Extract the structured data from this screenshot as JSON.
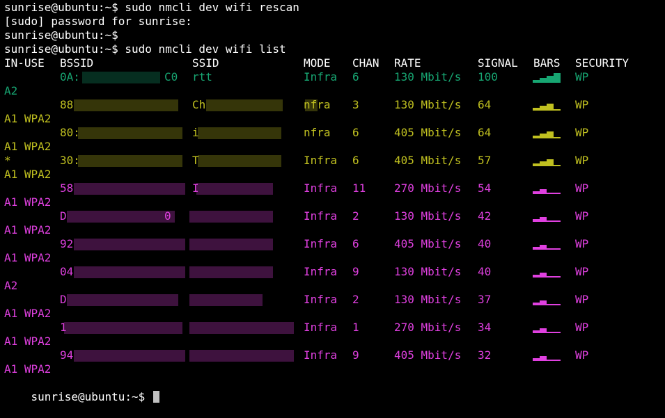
{
  "terminal": {
    "lines": [
      "sunrise@ubuntu:~$ sudo nmcli dev wifi rescan",
      "[sudo] password for sunrise:",
      "sunrise@ubuntu:~$",
      "sunrise@ubuntu:~$ sudo nmcli dev wifi list"
    ],
    "final_prompt": "sunrise@ubuntu:~$ "
  },
  "table": {
    "headers": {
      "in_use": "IN-USE",
      "bssid": "BSSID",
      "ssid": "SSID",
      "mode": "MODE",
      "chan": "CHAN",
      "rate": "RATE",
      "signal": "SIGNAL",
      "bars": "BARS",
      "security": "SECURITY"
    },
    "rows": [
      {
        "bssid": "0A:",
        "bssid_end": "C0",
        "ssid": "rtt",
        "mode": "Infra",
        "chan": "6",
        "rate": "130 Mbit/s",
        "signal": "100",
        "bars_level": 4,
        "security": "WP",
        "wrap": "A2",
        "in_use": "",
        "color": "#17a672"
      },
      {
        "bssid": "88",
        "bssid_end": "",
        "ssid": "Ch",
        "mode": "nfra",
        "chan": "3",
        "rate": "130 Mbit/s",
        "signal": "64",
        "bars_level": 3,
        "security": "WP",
        "wrap": "A1 WPA2",
        "in_use": "",
        "color": "#c0c020"
      },
      {
        "bssid": "80:",
        "bssid_end": "",
        "ssid": "i",
        "mode": "nfra",
        "chan": "6",
        "rate": "405 Mbit/s",
        "signal": "64",
        "bars_level": 3,
        "security": "WP",
        "wrap": "A1 WPA2",
        "in_use": "",
        "color": "#c0c020"
      },
      {
        "bssid": "30:",
        "bssid_end": "",
        "ssid": "T",
        "mode": "Infra",
        "chan": "6",
        "rate": "405 Mbit/s",
        "signal": "57",
        "bars_level": 3,
        "security": "WP",
        "wrap": "A1 WPA2",
        "in_use": "*",
        "color": "#c0c020"
      },
      {
        "bssid": "58",
        "bssid_end": "",
        "ssid": "I",
        "mode": "Infra",
        "chan": "11",
        "rate": "270 Mbit/s",
        "signal": "54",
        "bars_level": 2,
        "security": "WP",
        "wrap": "A1 WPA2",
        "in_use": "",
        "color": "#e040e0"
      },
      {
        "bssid": "D",
        "bssid_end": "0",
        "ssid": "",
        "mode": "Infra",
        "chan": "2",
        "rate": "130 Mbit/s",
        "signal": "42",
        "bars_level": 2,
        "security": "WP",
        "wrap": "A1 WPA2",
        "in_use": "",
        "color": "#e040e0"
      },
      {
        "bssid": "92",
        "bssid_end": "",
        "ssid": "",
        "mode": "Infra",
        "chan": "6",
        "rate": "405 Mbit/s",
        "signal": "40",
        "bars_level": 2,
        "security": "WP",
        "wrap": "A1 WPA2",
        "in_use": "",
        "color": "#e040e0"
      },
      {
        "bssid": "04",
        "bssid_end": "",
        "ssid": "",
        "mode": "Infra",
        "chan": "9",
        "rate": "130 Mbit/s",
        "signal": "40",
        "bars_level": 2,
        "security": "WP",
        "wrap": "A2",
        "in_use": "",
        "color": "#e040e0"
      },
      {
        "bssid": "D",
        "bssid_end": "",
        "ssid": "",
        "mode": "Infra",
        "chan": "2",
        "rate": "130 Mbit/s",
        "signal": "37",
        "bars_level": 2,
        "security": "WP",
        "wrap": "A1 WPA2",
        "in_use": "",
        "color": "#e040e0"
      },
      {
        "bssid": "1",
        "bssid_end": "",
        "ssid": "",
        "mode": "Infra",
        "chan": "1",
        "rate": "270 Mbit/s",
        "signal": "34",
        "bars_level": 2,
        "security": "WP",
        "wrap": "A1 WPA2",
        "in_use": "",
        "color": "#e040e0"
      },
      {
        "bssid": "94",
        "bssid_end": "",
        "ssid": "",
        "mode": "Infra",
        "chan": "9",
        "rate": "405 Mbit/s",
        "signal": "32",
        "bars_level": 2,
        "security": "WP",
        "wrap": "A1 WPA2",
        "in_use": "",
        "color": "#e040e0"
      }
    ]
  },
  "colors": {
    "background": "#000000",
    "text": "#ffffff",
    "strong": "#17a672",
    "medium": "#c0c020",
    "weak": "#e040e0",
    "bar_empty": "#3a3a3a",
    "cursor": "#c0c0c0"
  }
}
